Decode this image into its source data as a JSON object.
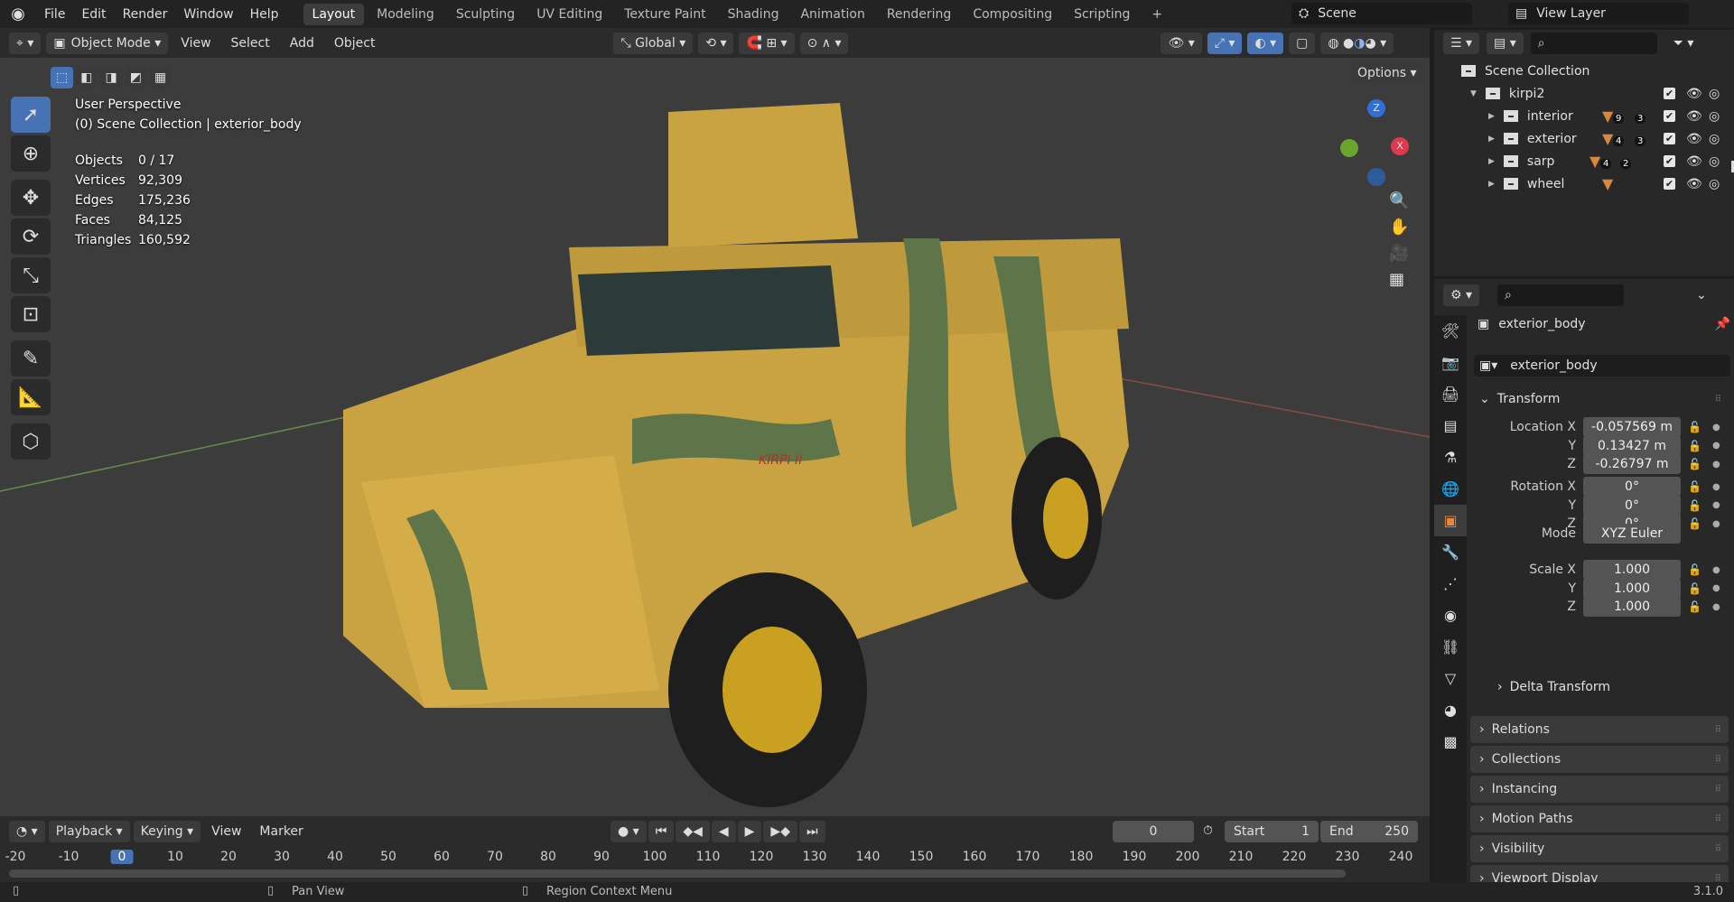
{
  "topbar": {
    "menus": [
      "File",
      "Edit",
      "Render",
      "Window",
      "Help"
    ],
    "workspaces": [
      "Layout",
      "Modeling",
      "Sculpting",
      "UV Editing",
      "Texture Paint",
      "Shading",
      "Animation",
      "Rendering",
      "Compositing",
      "Scripting"
    ],
    "add_tab": "+",
    "scene": "Scene",
    "view_layer": "View Layer"
  },
  "viewport_header": {
    "mode": "Object Mode",
    "menus": [
      "View",
      "Select",
      "Add",
      "Object"
    ],
    "orientation": "Global",
    "options": "Options"
  },
  "overlay": {
    "view_name": "User Perspective",
    "context": "(0) Scene Collection | exterior_body",
    "stats": [
      [
        "Objects",
        "0 / 17"
      ],
      [
        "Vertices",
        "92,309"
      ],
      [
        "Edges",
        "175,236"
      ],
      [
        "Faces",
        "84,125"
      ],
      [
        "Triangles",
        "160,592"
      ]
    ],
    "gizmo_z": "Z",
    "gizmo_x": "X",
    "vehicle_text": "KIRPI II"
  },
  "outliner": {
    "root": "Scene Collection",
    "items": [
      {
        "name": "kirpi2",
        "level": 0
      },
      {
        "name": "interior",
        "level": 1,
        "mesh": "9",
        "coll": "3"
      },
      {
        "name": "exterior",
        "level": 1,
        "mesh": "4",
        "coll": "3"
      },
      {
        "name": "sarp",
        "level": 1,
        "mesh": "4",
        "coll": "2"
      },
      {
        "name": "wheel",
        "level": 1,
        "mesh": "",
        "coll": ""
      }
    ]
  },
  "properties": {
    "object_name": "exterior_body",
    "datablock": "exterior_body",
    "transform": "Transform",
    "location_label": "Location X",
    "location": [
      "-0.057569 m",
      "0.13427 m",
      "-0.26797 m"
    ],
    "rotation_label": "Rotation X",
    "rotation": [
      "0°",
      "0°",
      "0°"
    ],
    "mode_label": "Mode",
    "mode": "XYZ Euler",
    "scale_label": "Scale X",
    "scale": [
      "1.000",
      "1.000",
      "1.000"
    ],
    "axis_y": "Y",
    "axis_z": "Z",
    "delta": "Delta Transform",
    "panels": [
      "Relations",
      "Collections",
      "Instancing",
      "Motion Paths",
      "Visibility",
      "Viewport Display"
    ]
  },
  "timeline": {
    "menus": [
      "Playback",
      "Keying",
      "View",
      "Marker"
    ],
    "current_frame": "0",
    "start_label": "Start",
    "start": "1",
    "end_label": "End",
    "end": "250",
    "ticks": [
      "-20",
      "-10",
      "0",
      "10",
      "20",
      "30",
      "40",
      "50",
      "60",
      "70",
      "80",
      "90",
      "100",
      "110",
      "120",
      "130",
      "140",
      "150",
      "160",
      "170",
      "180",
      "190",
      "200",
      "210",
      "220",
      "230",
      "240"
    ]
  },
  "status": {
    "pan": "Pan View",
    "context": "Region Context Menu",
    "version": "3.1.0"
  },
  "colors": {
    "accent": "#4772b3",
    "selected_frame": "#4772b3"
  }
}
